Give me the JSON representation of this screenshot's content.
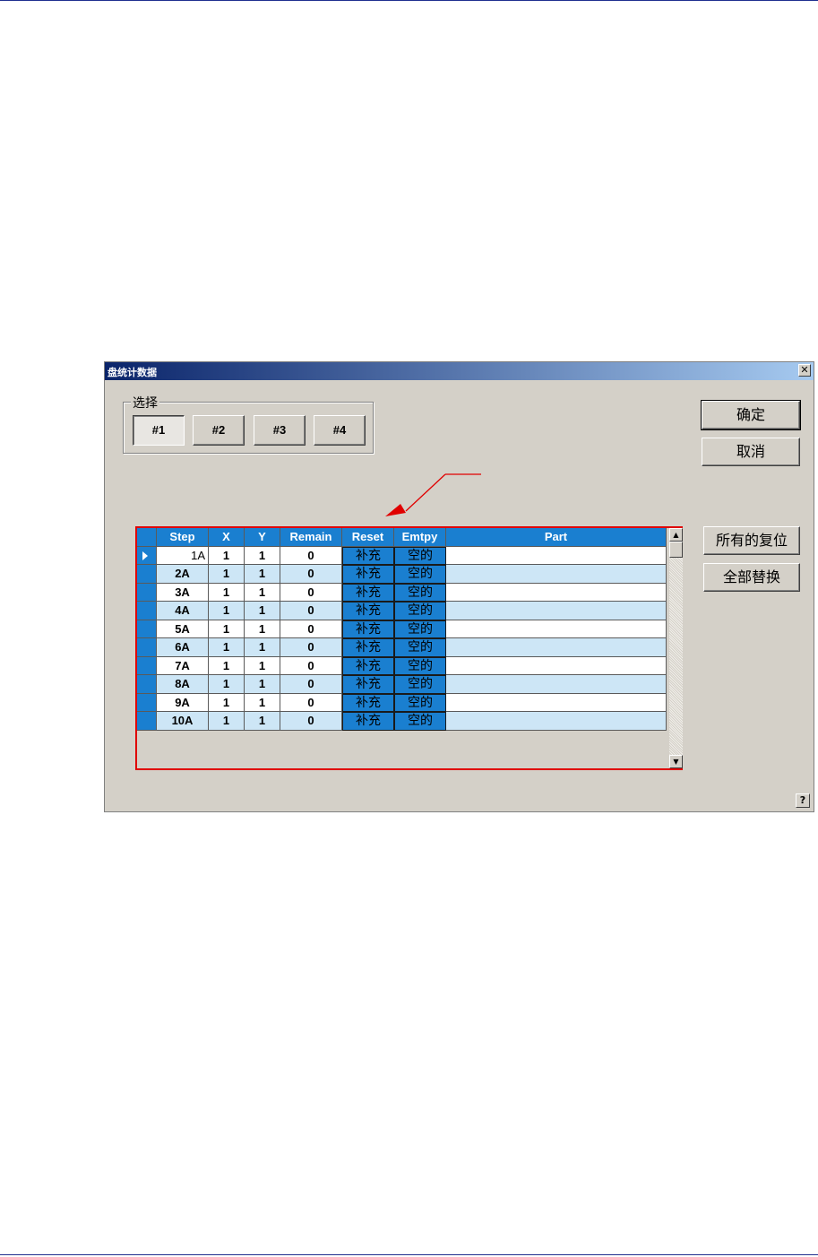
{
  "dialog": {
    "title": "盘统计数据",
    "close_glyph": "✕",
    "help_glyph": "?"
  },
  "group": {
    "label": "选择",
    "buttons": [
      "#1",
      "#2",
      "#3",
      "#4"
    ],
    "selected": "#1"
  },
  "actions": {
    "ok": "确定",
    "cancel": "取消",
    "reset_all": "所有的复位",
    "replace_all": "全部替换"
  },
  "table": {
    "columns": [
      "Step",
      "X",
      "Y",
      "Remain",
      "Reset",
      "Emtpy",
      "Part"
    ],
    "rows": [
      {
        "step": "1A",
        "x": "1",
        "y": "1",
        "remain": "0",
        "reset": "补充",
        "empty": "空的",
        "part": ""
      },
      {
        "step": "2A",
        "x": "1",
        "y": "1",
        "remain": "0",
        "reset": "补充",
        "empty": "空的",
        "part": ""
      },
      {
        "step": "3A",
        "x": "1",
        "y": "1",
        "remain": "0",
        "reset": "补充",
        "empty": "空的",
        "part": ""
      },
      {
        "step": "4A",
        "x": "1",
        "y": "1",
        "remain": "0",
        "reset": "补充",
        "empty": "空的",
        "part": ""
      },
      {
        "step": "5A",
        "x": "1",
        "y": "1",
        "remain": "0",
        "reset": "补充",
        "empty": "空的",
        "part": ""
      },
      {
        "step": "6A",
        "x": "1",
        "y": "1",
        "remain": "0",
        "reset": "补充",
        "empty": "空的",
        "part": ""
      },
      {
        "step": "7A",
        "x": "1",
        "y": "1",
        "remain": "0",
        "reset": "补充",
        "empty": "空的",
        "part": ""
      },
      {
        "step": "8A",
        "x": "1",
        "y": "1",
        "remain": "0",
        "reset": "补充",
        "empty": "空的",
        "part": ""
      },
      {
        "step": "9A",
        "x": "1",
        "y": "1",
        "remain": "0",
        "reset": "补充",
        "empty": "空的",
        "part": ""
      },
      {
        "step": "10A",
        "x": "1",
        "y": "1",
        "remain": "0",
        "reset": "补充",
        "empty": "空的",
        "part": ""
      }
    ]
  },
  "colors": {
    "header_blue": "#1a7fd0",
    "highlight_red": "#e00000",
    "alt_row": "#cde6f6"
  }
}
